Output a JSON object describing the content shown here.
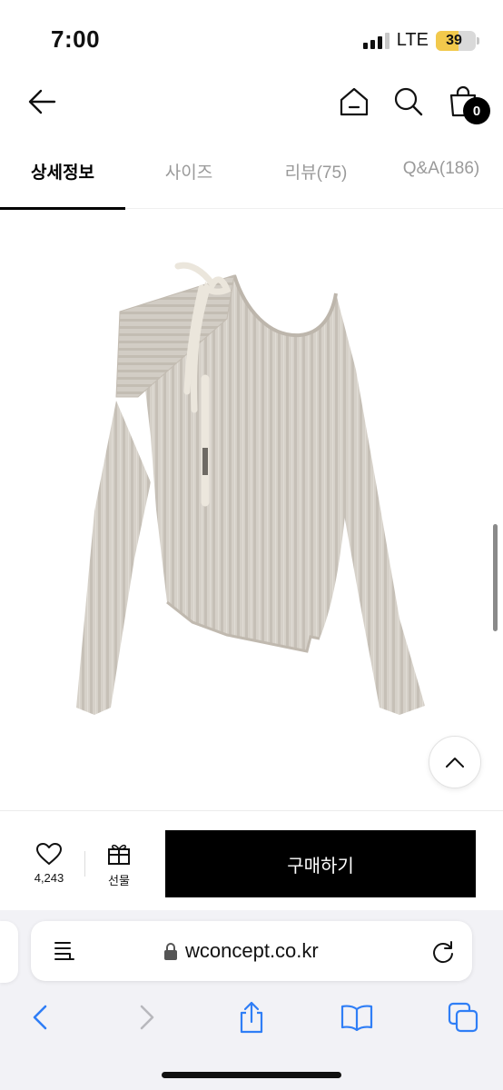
{
  "status_bar": {
    "time": "7:00",
    "network": "LTE",
    "battery": "39",
    "battery_level": 0.39
  },
  "header": {
    "icons": [
      "back-arrow-icon",
      "home-icon",
      "search-icon",
      "shopping-bag-icon"
    ],
    "cart_count": "0"
  },
  "tabs": [
    {
      "label": "상세정보",
      "active": true
    },
    {
      "label": "사이즈",
      "active": false
    },
    {
      "label": "리뷰(75)",
      "active": false
    },
    {
      "label": "Q&A(186)",
      "active": false
    }
  ],
  "product": {
    "image_icon": "knit-sweater-image",
    "scroll_top_icon": "chevron-up-icon"
  },
  "purchase_bar": {
    "like_count": "4,243",
    "gift_label": "선물",
    "buy_label": "구매하기"
  },
  "browser": {
    "url": "wconcept.co.kr",
    "icons": [
      "reader-icon",
      "lock-icon",
      "reload-icon",
      "back-icon",
      "forward-icon",
      "share-icon",
      "bookmarks-icon",
      "tabs-icon"
    ]
  },
  "colors": {
    "accent": "#000000",
    "battery": "#f2c94c",
    "browser_blue": "#2f7ef6",
    "sweater": "#d4cfc7"
  }
}
